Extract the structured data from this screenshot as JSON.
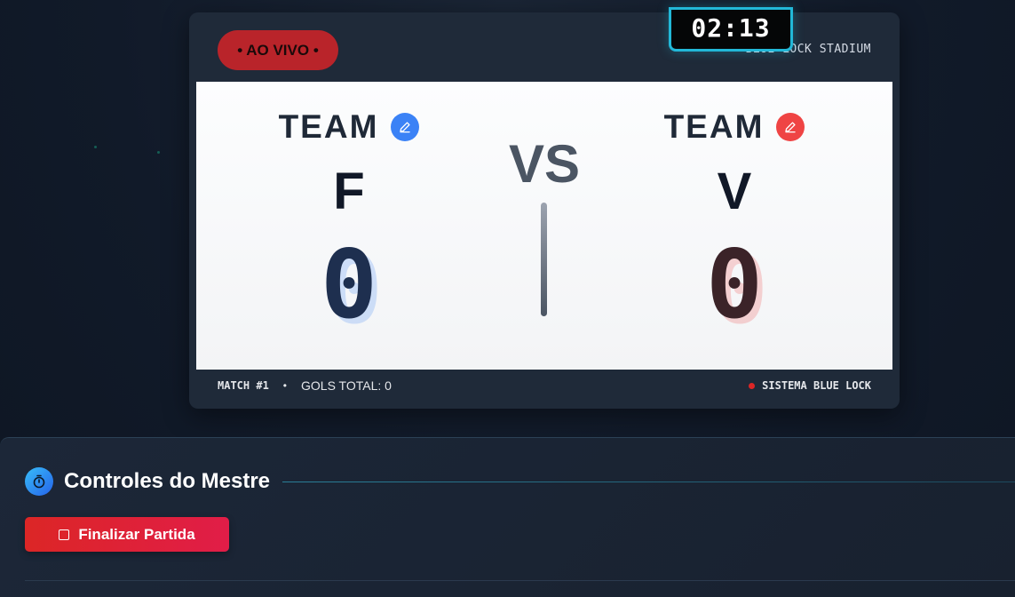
{
  "scoreboard": {
    "timer": "02:13",
    "live_badge": "• AO VIVO •",
    "stadium": "BLUE LOCK STADIUM",
    "vs_label": "VS",
    "home": {
      "label": "TEAM",
      "name": "F",
      "score": "0",
      "accent_color": "#3b82f6"
    },
    "away": {
      "label": "TEAM",
      "name": "V",
      "score": "0",
      "accent_color": "#ef4444"
    },
    "footer": {
      "match": "MATCH #1",
      "separator": "•",
      "total_goals": "GOLS TOTAL: 0",
      "system": "SISTEMA BLUE LOCK"
    }
  },
  "controls": {
    "title": "Controles do Mestre",
    "finish_button": "Finalizar Partida",
    "icon": "stopwatch-icon"
  },
  "colors": {
    "timer_border": "#22b8d8",
    "live_badge": "#b9242a",
    "finish_button": "#dc2626"
  }
}
